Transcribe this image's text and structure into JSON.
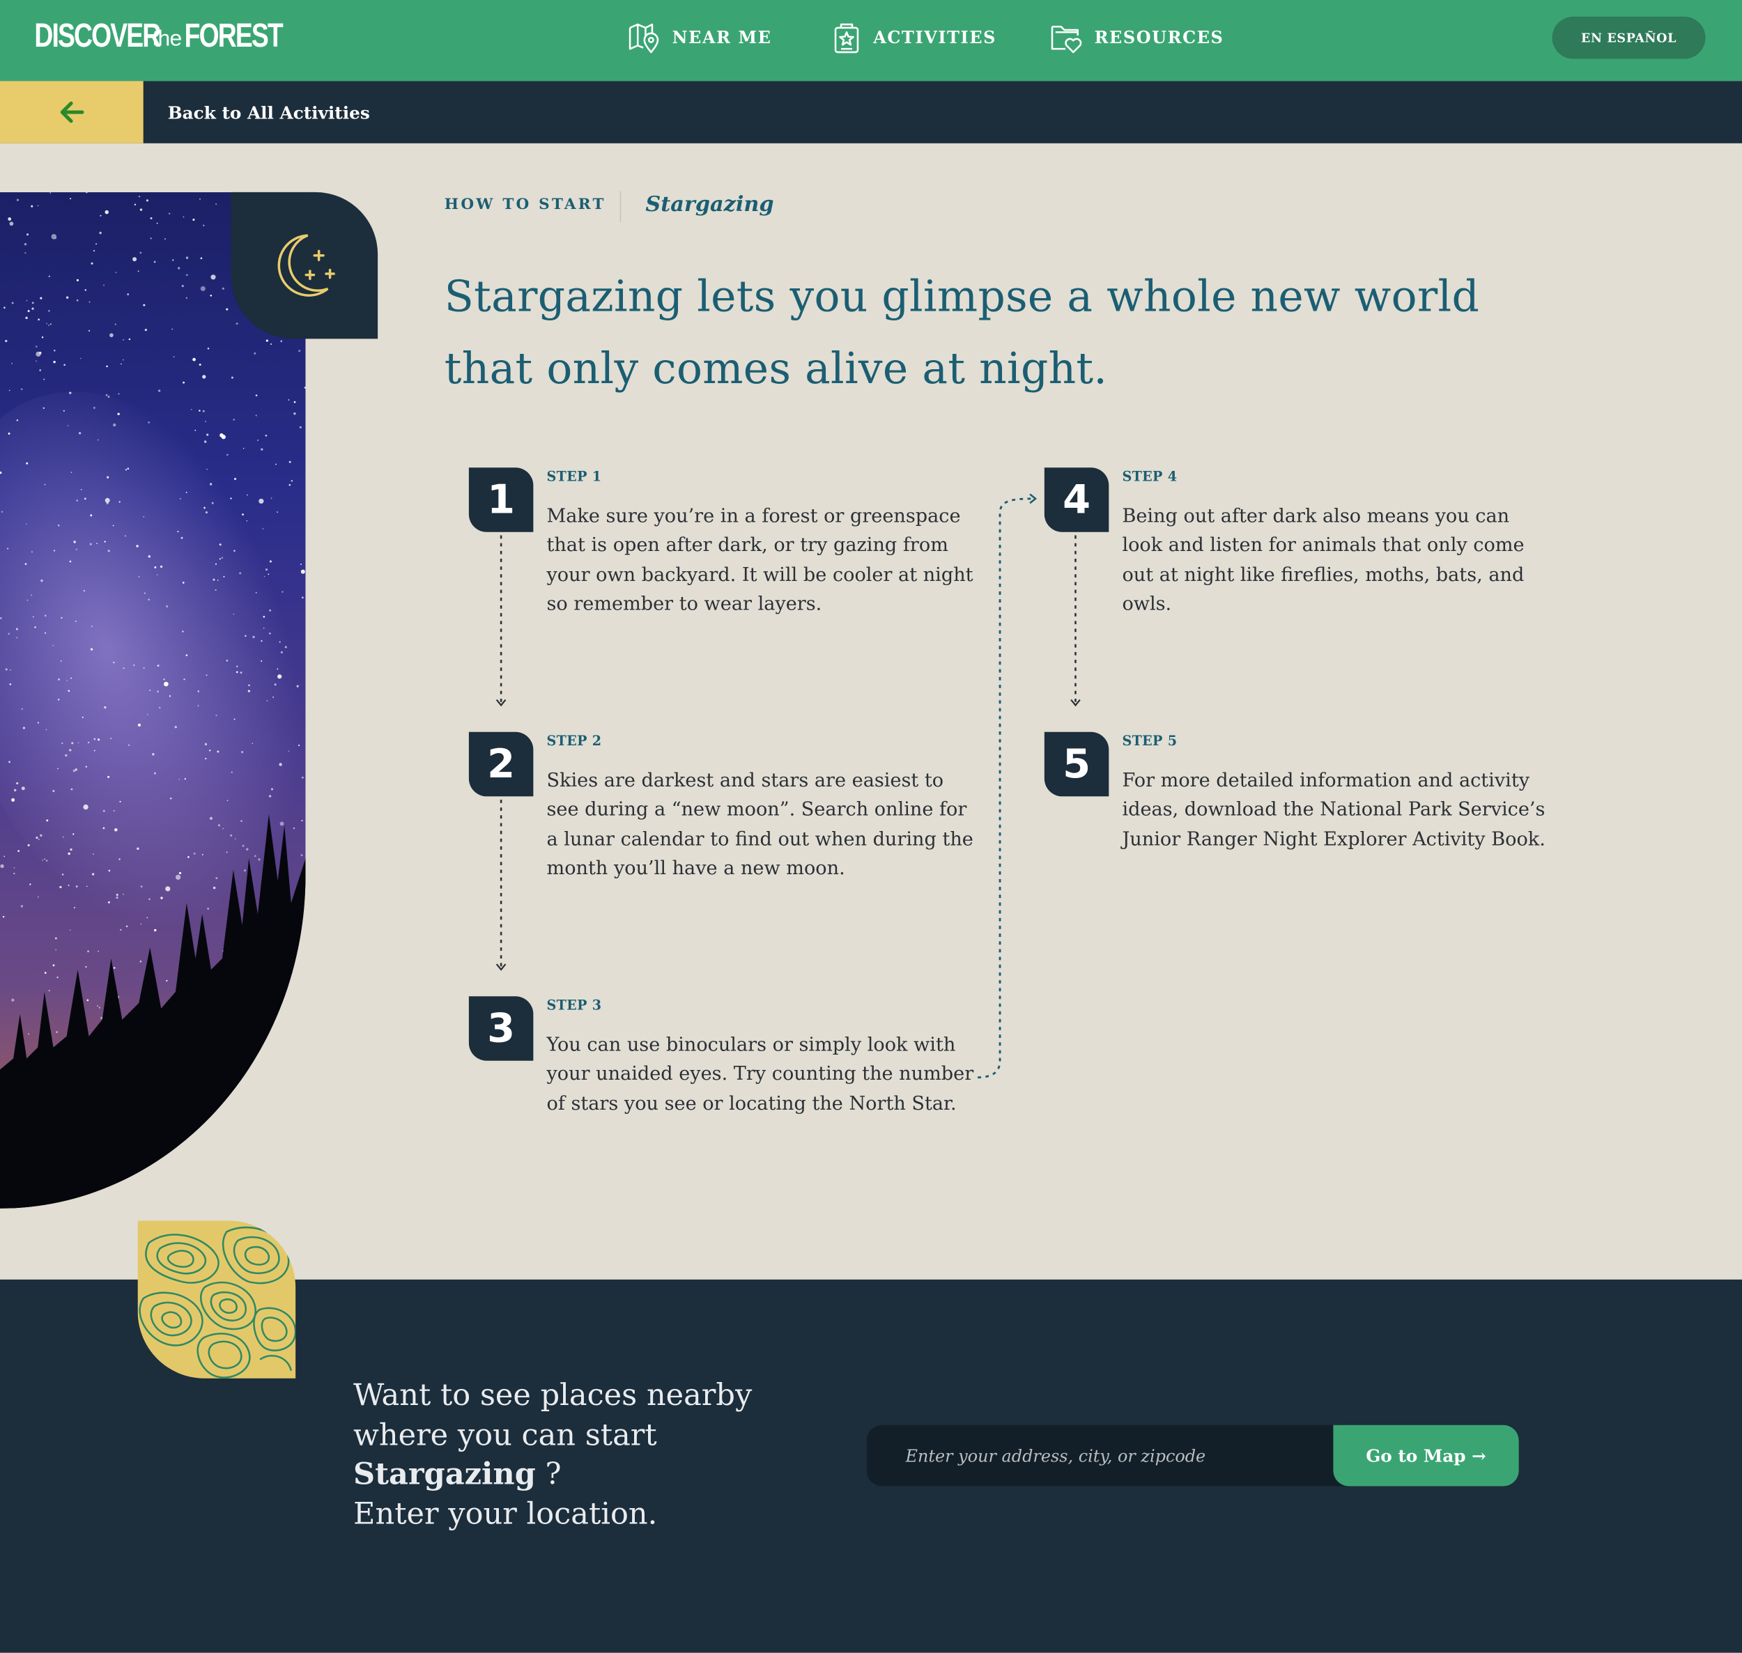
{
  "brand": {
    "logo_word1": "DISCOVER",
    "logo_word2": "the",
    "logo_word3": "FOREST"
  },
  "nav": {
    "items": [
      {
        "label": "NEAR ME",
        "icon": "map-pin-icon"
      },
      {
        "label": "ACTIVITIES",
        "icon": "activity-card-icon"
      },
      {
        "label": "RESOURCES",
        "icon": "folder-heart-icon"
      }
    ],
    "language_button": "EN ESPAÑOL"
  },
  "back": {
    "label": "Back to All Activities",
    "icon": "arrow-left-icon"
  },
  "breadcrumb": {
    "section": "HOW TO START",
    "activity": "Stargazing"
  },
  "headline": "Stargazing lets you glimpse a whole new world that only comes alive at night.",
  "steps": [
    {
      "number": "1",
      "label": "STEP 1",
      "text": "Make sure you’re in a forest or greenspace that is open after dark, or try gazing from your own backyard. It will be cooler at night so remember to wear layers."
    },
    {
      "number": "2",
      "label": "STEP 2",
      "text": "Skies are darkest and stars are easiest to see during a “new moon”. Search online for a lunar calendar to find out when during the month you’ll have a new moon."
    },
    {
      "number": "3",
      "label": "STEP 3",
      "text": "You can use binoculars or simply look with your unaided eyes. Try counting the number of stars you see or locating the North Star."
    },
    {
      "number": "4",
      "label": "STEP 4",
      "text": "Being out after dark also means you can look and listen for animals that only come out at night like fireflies, moths, bats, and owls."
    },
    {
      "number": "5",
      "label": "STEP 5",
      "text": "For more detailed information and activity ideas, download the National Park Service’s Junior Ranger Night Explorer Activity Book."
    }
  ],
  "cta": {
    "line1": "Want to see places nearby",
    "line2": "where you can start",
    "activity": "Stargazing",
    "question_mark": "?",
    "line3": "Enter your location."
  },
  "search": {
    "placeholder": "Enter your address, city, or zipcode",
    "value": "",
    "button": "Go to Map →"
  },
  "colors": {
    "brand_green": "#3aa573",
    "navy": "#1c2d3b",
    "accent_yellow": "#e8cc6c",
    "teal_text": "#1b5e73",
    "page_bg": "#e2ded3"
  }
}
